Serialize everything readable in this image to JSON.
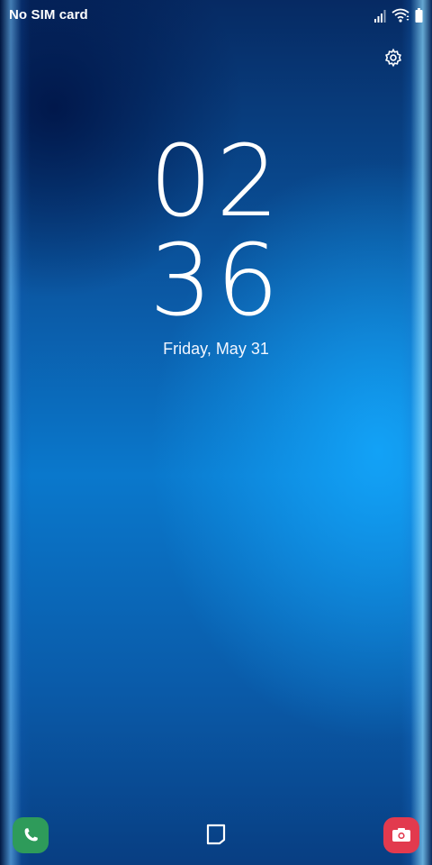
{
  "status_bar": {
    "carrier": "No SIM card",
    "icons": [
      "signal-icon",
      "wifi-icon",
      "battery-icon"
    ]
  },
  "lock_screen": {
    "hours": "02",
    "minutes": "36",
    "date": "Friday, May 31",
    "settings_icon": "gear-icon"
  },
  "shortcuts": {
    "left": "phone-icon",
    "right": "camera-icon",
    "left_color": "#2e9b5a",
    "right_color": "#e23a4e"
  },
  "nav": {
    "recent_icon": "recent-apps-icon"
  }
}
